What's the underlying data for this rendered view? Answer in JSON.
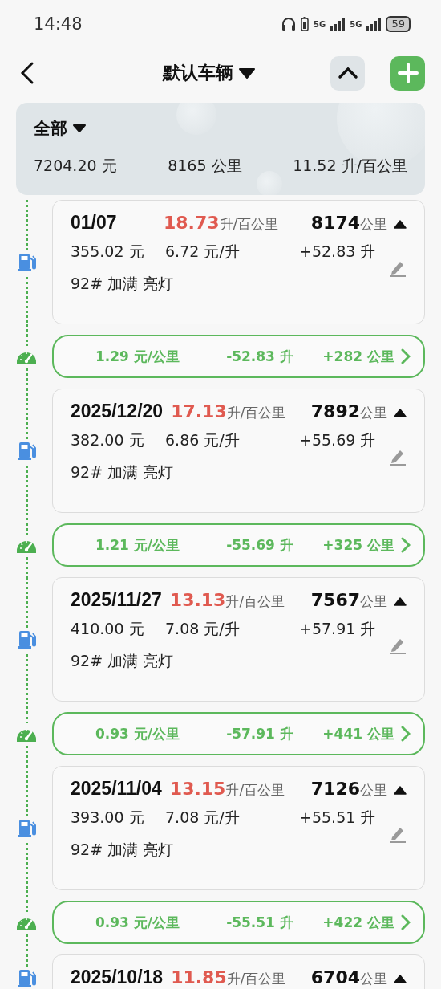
{
  "status_bar": {
    "time": "14:48",
    "network_1": "5G",
    "network_2": "5G",
    "battery": "59"
  },
  "header": {
    "title": "默认车辆"
  },
  "summary": {
    "filter": "全部",
    "total_cost": "7204.20 元",
    "total_distance": "8165 公里",
    "average_consumption": "11.52 升/百公里"
  },
  "entries": [
    {
      "kind": "fill",
      "date": "01/07",
      "consumption": "18.73",
      "consumption_unit": "升/百公里",
      "odometer": "8174",
      "odometer_unit": "公里",
      "amount": "355.02 元",
      "price": "6.72 元/升",
      "volume": "+52.83 升",
      "note": "92# 加满 亮灯"
    },
    {
      "kind": "interval",
      "cost_per_km": "1.29 元/公里",
      "fuel_used": "-52.83 升",
      "distance": "+282 公里"
    },
    {
      "kind": "fill",
      "date": "2025/12/20",
      "consumption": "17.13",
      "consumption_unit": "升/百公里",
      "odometer": "7892",
      "odometer_unit": "公里",
      "amount": "382.00 元",
      "price": "6.86 元/升",
      "volume": "+55.69 升",
      "note": "92# 加满 亮灯"
    },
    {
      "kind": "interval",
      "cost_per_km": "1.21 元/公里",
      "fuel_used": "-55.69 升",
      "distance": "+325 公里"
    },
    {
      "kind": "fill",
      "date": "2025/11/27",
      "consumption": "13.13",
      "consumption_unit": "升/百公里",
      "odometer": "7567",
      "odometer_unit": "公里",
      "amount": "410.00 元",
      "price": "7.08 元/升",
      "volume": "+57.91 升",
      "note": "92# 加满 亮灯"
    },
    {
      "kind": "interval",
      "cost_per_km": "0.93 元/公里",
      "fuel_used": "-57.91 升",
      "distance": "+441 公里"
    },
    {
      "kind": "fill",
      "date": "2025/11/04",
      "consumption": "13.15",
      "consumption_unit": "升/百公里",
      "odometer": "7126",
      "odometer_unit": "公里",
      "amount": "393.00 元",
      "price": "7.08 元/升",
      "volume": "+55.51 升",
      "note": "92# 加满 亮灯"
    },
    {
      "kind": "interval",
      "cost_per_km": "0.93 元/公里",
      "fuel_used": "-55.51 升",
      "distance": "+422 公里"
    },
    {
      "kind": "fill",
      "date": "2025/10/18",
      "consumption": "11.85",
      "consumption_unit": "升/百公里",
      "odometer": "6704",
      "odometer_unit": "公里"
    }
  ]
}
